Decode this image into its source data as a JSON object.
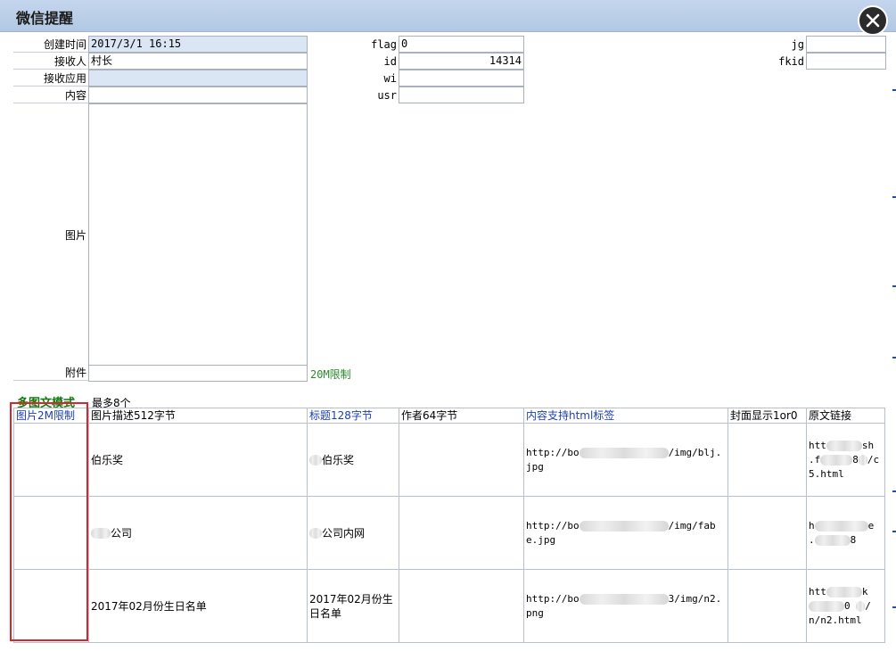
{
  "window": {
    "title": "微信提醒",
    "close_label": "close"
  },
  "form": {
    "created_label": "创建时间",
    "created_value": "2017/3/1 16:15",
    "receiver_label": "接收人",
    "receiver_value": "村长",
    "app_label": "接收应用",
    "app_value": "",
    "content_label": "内容",
    "content_value": "",
    "image_label": "图片",
    "attachment_label": "附件",
    "attachment_note": "20M限制",
    "flag_label": "flag",
    "flag_value": "0",
    "id_label": "id",
    "id_value": "14314",
    "wi_label": "wi",
    "wi_value": "",
    "usr_label": "usr",
    "usr_value": "",
    "jg_label": "jg",
    "jg_value": "",
    "fkid_label": "fkid",
    "fkid_value": ""
  },
  "multi_news": {
    "mode_label": "多图文模式",
    "limit_label": "最多8个",
    "headers": [
      "图片2M限制",
      "图片描述512字节",
      "标题128字节",
      "作者64字节",
      "内容支持html标签",
      "封面显示1or0",
      "原文链接"
    ],
    "rows": [
      {
        "desc": "伯乐奖",
        "title": "伯乐奖",
        "author": "",
        "content_pre": "http://bo",
        "content_post": "/img/blj.jpg",
        "cover": "",
        "link_a": "htt",
        "link_b": "sh",
        "link_c": ".f",
        "link_d": "8",
        "link_e": "/c5.html"
      },
      {
        "desc": "公司",
        "title": "公司内网",
        "author": "",
        "content_pre": "http://bo",
        "content_post": "/img/fabe.jpg",
        "cover": "",
        "link_a": "h",
        "link_b": "e",
        "link_c": ".",
        "link_d": "8",
        "link_e": ""
      },
      {
        "desc": "2017年02月份生日名单",
        "title": "2017年02月份生日名单",
        "author": "",
        "content_pre": "http://bo",
        "content_post": "3/img/n2.png",
        "cover": "",
        "link_a": "htt",
        "link_b": "k",
        "link_c": "0",
        "link_d": "",
        "link_e": "/n/n2.html"
      }
    ]
  },
  "colors": {
    "titlebar": "#b8cce6",
    "label_blue": "#1a3fb8",
    "green": "#0a7a0a",
    "highlight": "#d9262c",
    "field_blue": "#dbe6f4"
  }
}
